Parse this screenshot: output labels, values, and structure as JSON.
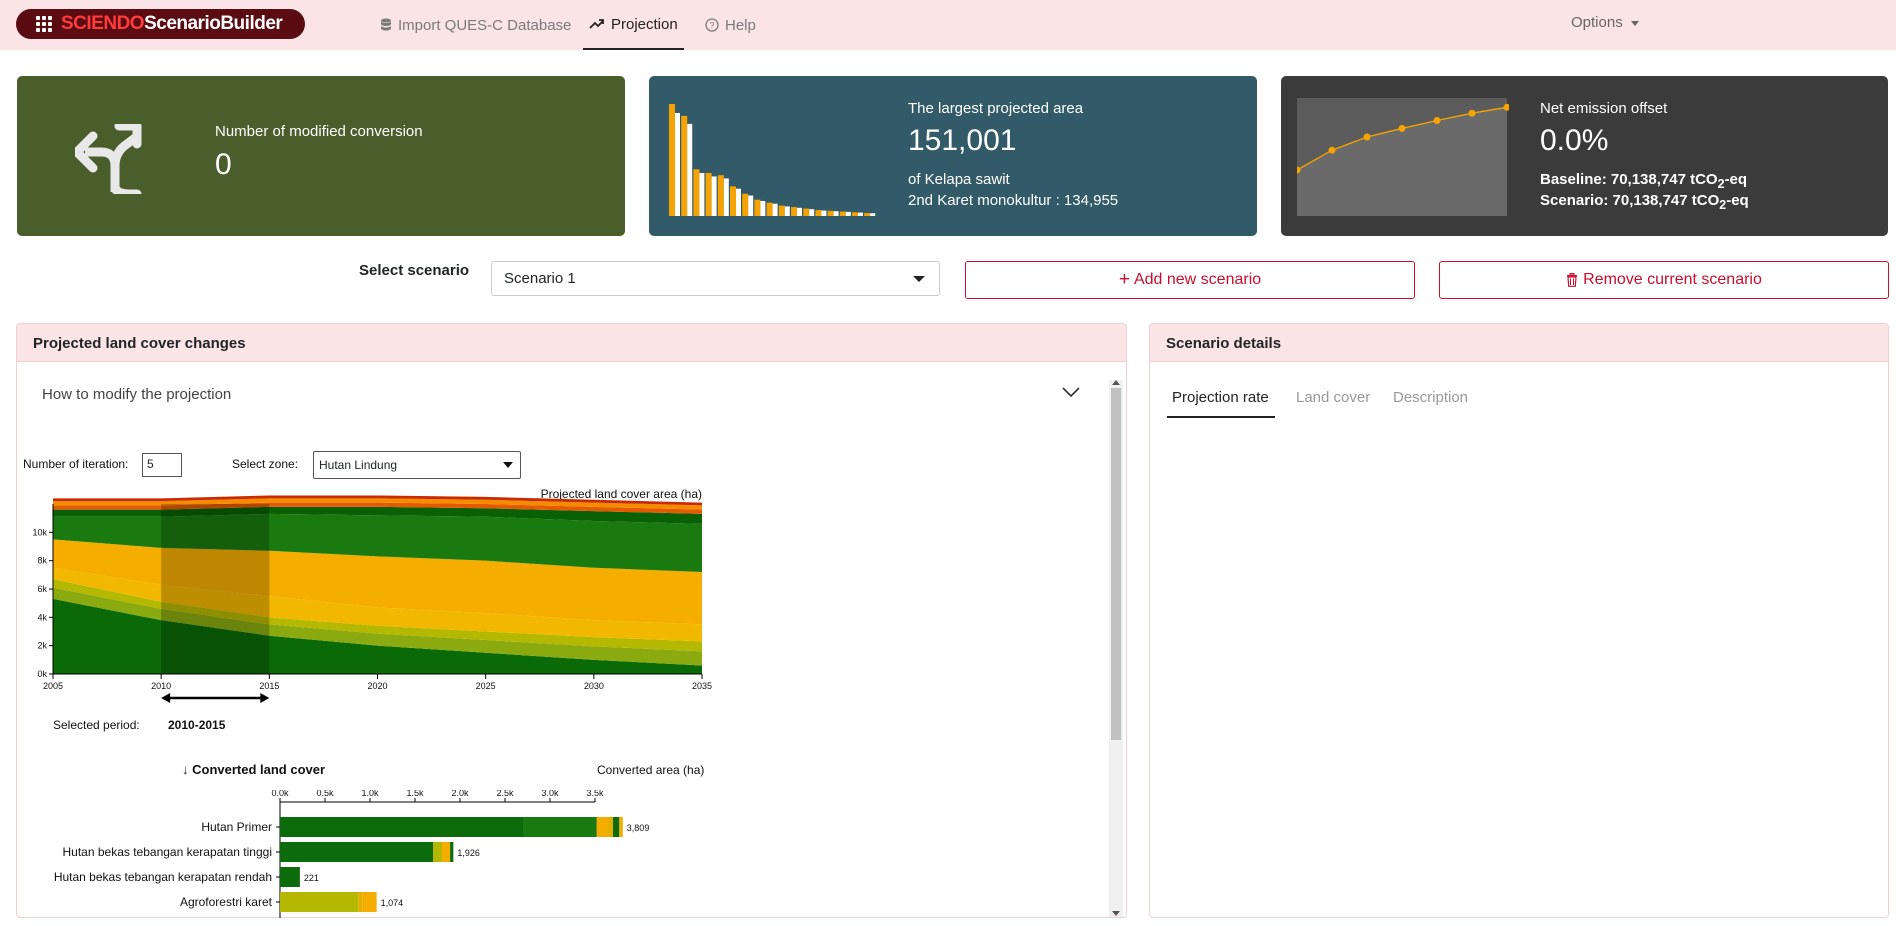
{
  "brand": {
    "part1": "SCIENDO",
    "part2": "ScenarioBuilder"
  },
  "nav": {
    "items": [
      {
        "label": "Import QUES-C Database",
        "icon": "database-icon"
      },
      {
        "label": "Projection",
        "icon": "trending-up-icon"
      },
      {
        "label": "Help",
        "icon": "question-circle-icon"
      }
    ],
    "options": "Options"
  },
  "cards": {
    "modified": {
      "label": "Number of modified conversion",
      "value": "0",
      "color": "#4a5e2b"
    },
    "largest": {
      "label": "The largest projected area",
      "value": "151,001",
      "sub1": "of Kelapa sawit",
      "sub2": "2nd Karet monokultur : 134,955",
      "color": "#325a68"
    },
    "emission": {
      "label": "Net emission offset",
      "value": "0.0%",
      "baseline": "Baseline: 70,138,747 tCO",
      "scenario": "Scenario: 70,138,747 tCO",
      "sub_2": "2",
      "suffix": "-eq",
      "color": "#3b3b3b"
    }
  },
  "scenario": {
    "select_label": "Select scenario",
    "selected": "Scenario 1",
    "add_label": "Add new scenario",
    "remove_label": "Remove current scenario"
  },
  "left_panel": {
    "title": "Projected land cover changes",
    "accordion": "How to modify the projection",
    "iteration_label": "Number of iteration:",
    "iteration_value": "5",
    "zone_label": "Select zone:",
    "zone_value": "Hutan Lindung",
    "selected_period_label": "Selected period:",
    "selected_period_value": "2010-2015",
    "converted_title": "↓ Converted land cover",
    "converted_area_title": "Converted area (ha)"
  },
  "right_panel": {
    "title": "Scenario details",
    "tabs": [
      "Projection rate",
      "Land cover",
      "Description"
    ]
  },
  "chart_data": [
    {
      "type": "area",
      "title": "Projected land cover area (ha)",
      "x": [
        2005,
        2010,
        2015,
        2020,
        2025,
        2030,
        2035
      ],
      "xlim": [
        2005,
        2035
      ],
      "ylim": [
        0,
        12000
      ],
      "y_ticks": [
        "0k",
        "2k",
        "4k",
        "6k",
        "8k",
        "10k"
      ],
      "x_ticks": [
        "2005",
        "2010",
        "2015",
        "2020",
        "2025",
        "2030",
        "2035"
      ],
      "highlight_period": [
        2010,
        2015
      ],
      "series": [
        {
          "color": "#0b6a08",
          "values": [
            5300,
            3800,
            2700,
            2000,
            1500,
            1000,
            600
          ]
        },
        {
          "color": "#8aaa10",
          "values": [
            800,
            800,
            800,
            850,
            900,
            950,
            1000
          ]
        },
        {
          "color": "#b5b800",
          "values": [
            600,
            500,
            500,
            550,
            600,
            650,
            700
          ]
        },
        {
          "color": "#f2b800",
          "values": [
            800,
            1200,
            1500,
            1300,
            1300,
            1200,
            1200
          ]
        },
        {
          "color": "#f5ad00",
          "values": [
            2000,
            2600,
            3200,
            3600,
            3700,
            3700,
            3700
          ]
        },
        {
          "color": "#1a7a10",
          "values": [
            1600,
            2200,
            2600,
            2900,
            3100,
            3300,
            3400
          ]
        },
        {
          "color": "#0a6105",
          "values": [
            500,
            500,
            500,
            600,
            600,
            700,
            700
          ]
        },
        {
          "color": "#e35a00",
          "values": [
            300,
            300,
            300,
            300,
            300,
            300,
            300
          ]
        },
        {
          "color": "#f58c00",
          "values": [
            300,
            300,
            300,
            300,
            300,
            300,
            300
          ]
        },
        {
          "color": "#c92a00",
          "values": [
            200,
            200,
            200,
            200,
            200,
            200,
            200
          ]
        }
      ]
    },
    {
      "type": "bar",
      "title": "Converted area (ha)",
      "x_ticks": [
        "0.0k",
        "0.5k",
        "1.0k",
        "1.5k",
        "2.0k",
        "2.5k",
        "3.0k",
        "3.5k"
      ],
      "xlim": [
        0,
        3800
      ],
      "categories": [
        "Hutan Primer",
        "Hutan bekas tebangan kerapatan tinggi",
        "Hutan bekas tebangan kerapatan rendah",
        "Agroforestri karet"
      ],
      "totals": [
        "3,809",
        "1,926",
        "221",
        "1,074"
      ],
      "segments": [
        [
          {
            "v": 2700,
            "c": "#0c6b0a"
          },
          {
            "v": 820,
            "c": "#197a12"
          },
          {
            "v": 130,
            "c": "#f5ad00"
          },
          {
            "v": 50,
            "c": "#e3b000"
          },
          {
            "v": 70,
            "c": "#0c6b0a"
          },
          {
            "v": 39,
            "c": "#f5ad00"
          }
        ],
        [
          {
            "v": 1700,
            "c": "#0c6b0a"
          },
          {
            "v": 100,
            "c": "#b5b800"
          },
          {
            "v": 90,
            "c": "#f5ad00"
          },
          {
            "v": 36,
            "c": "#0c6b0a"
          }
        ],
        [
          {
            "v": 221,
            "c": "#0c6b0a"
          }
        ],
        [
          {
            "v": 870,
            "c": "#b5b800"
          },
          {
            "v": 50,
            "c": "#e3b000"
          },
          {
            "v": 154,
            "c": "#f5ad00"
          }
        ]
      ]
    },
    {
      "type": "bar",
      "values": [
        151001,
        134955,
        63000,
        58000,
        55000,
        40000,
        30000,
        22000,
        18000,
        14000,
        12000,
        10000,
        8000,
        7000,
        6000,
        5000,
        4000
      ],
      "colors": [
        "#f5a300",
        "#ffffff"
      ]
    },
    {
      "type": "line",
      "values": [
        0,
        0.3,
        0.5,
        0.63,
        0.75,
        0.86,
        0.95
      ],
      "ylim": [
        0,
        1
      ]
    }
  ]
}
